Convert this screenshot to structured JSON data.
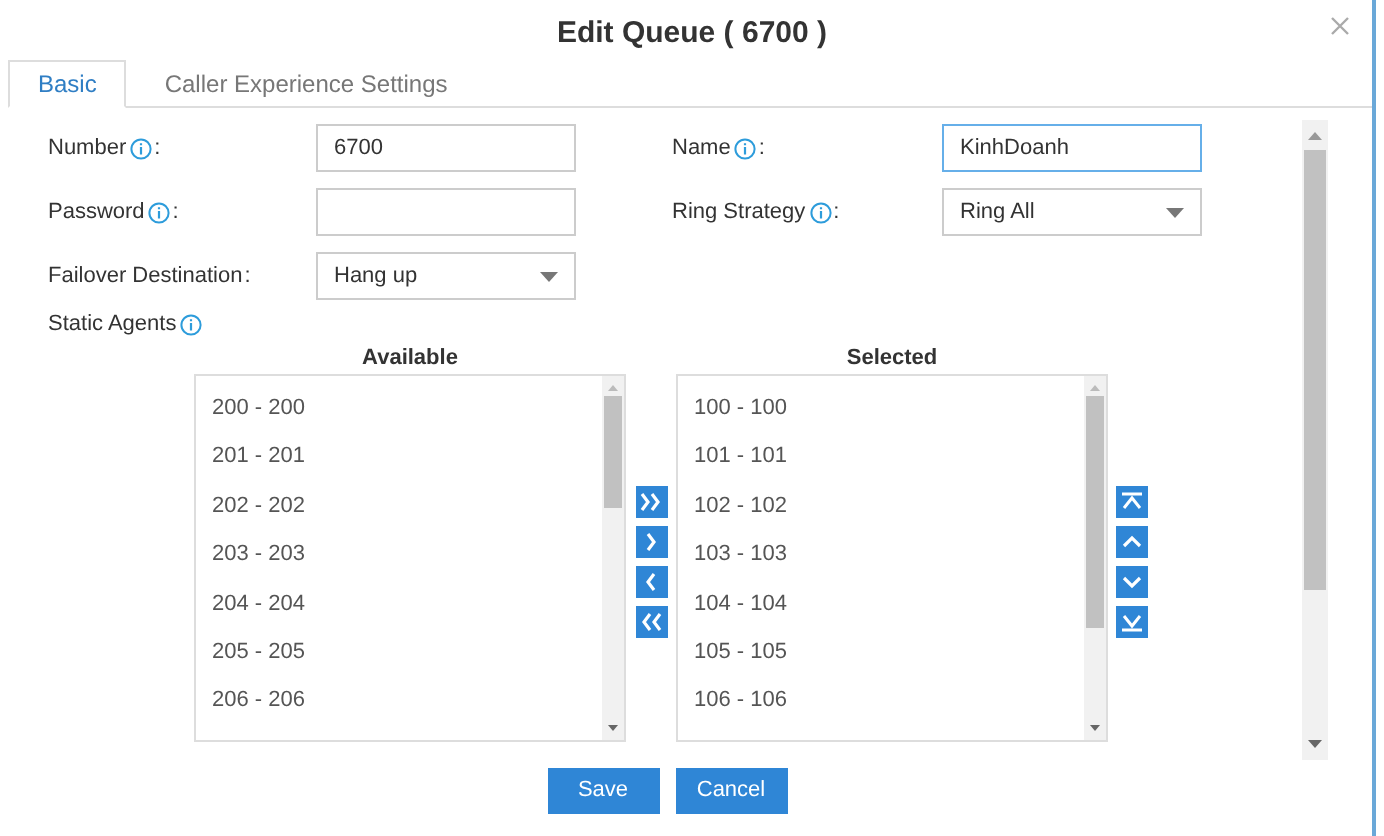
{
  "dialog": {
    "title": "Edit Queue ( 6700 )"
  },
  "tabs": [
    {
      "label": "Basic",
      "selected": true
    },
    {
      "label": "Caller Experience Settings",
      "selected": false
    }
  ],
  "fields": [
    {
      "label": "Number",
      "info": true,
      "colon": ":",
      "kind": "input",
      "value": "6700",
      "focused": false
    },
    {
      "label": "Name",
      "info": true,
      "colon": ":",
      "kind": "input",
      "value": "KinhDoanh",
      "focused": true
    },
    {
      "label": "Password",
      "info": true,
      "colon": ":",
      "kind": "input",
      "focused": false
    },
    {
      "label": "Ring Strategy",
      "info": true,
      "colon": ":",
      "kind": "select",
      "value": "Ring All",
      "focused": false
    },
    {
      "label": "Failover Destination",
      "info": false,
      "colon": ":",
      "kind": "select",
      "value": "Hang up",
      "focused": false
    }
  ],
  "static_agents": {
    "label": "Static Agents",
    "available_heading": "Available",
    "selected_heading": "Selected",
    "available": [
      "200 - 200",
      "201 - 201",
      "202 - 202",
      "203 - 203",
      "204 - 204",
      "205 - 205",
      "206 - 206"
    ],
    "selected": [
      "100 - 100",
      "101 - 101",
      "102 - 102",
      "103 - 103",
      "104 - 104",
      "105 - 105",
      "106 - 106"
    ]
  },
  "buttons": [
    "Save",
    "Cancel"
  ]
}
